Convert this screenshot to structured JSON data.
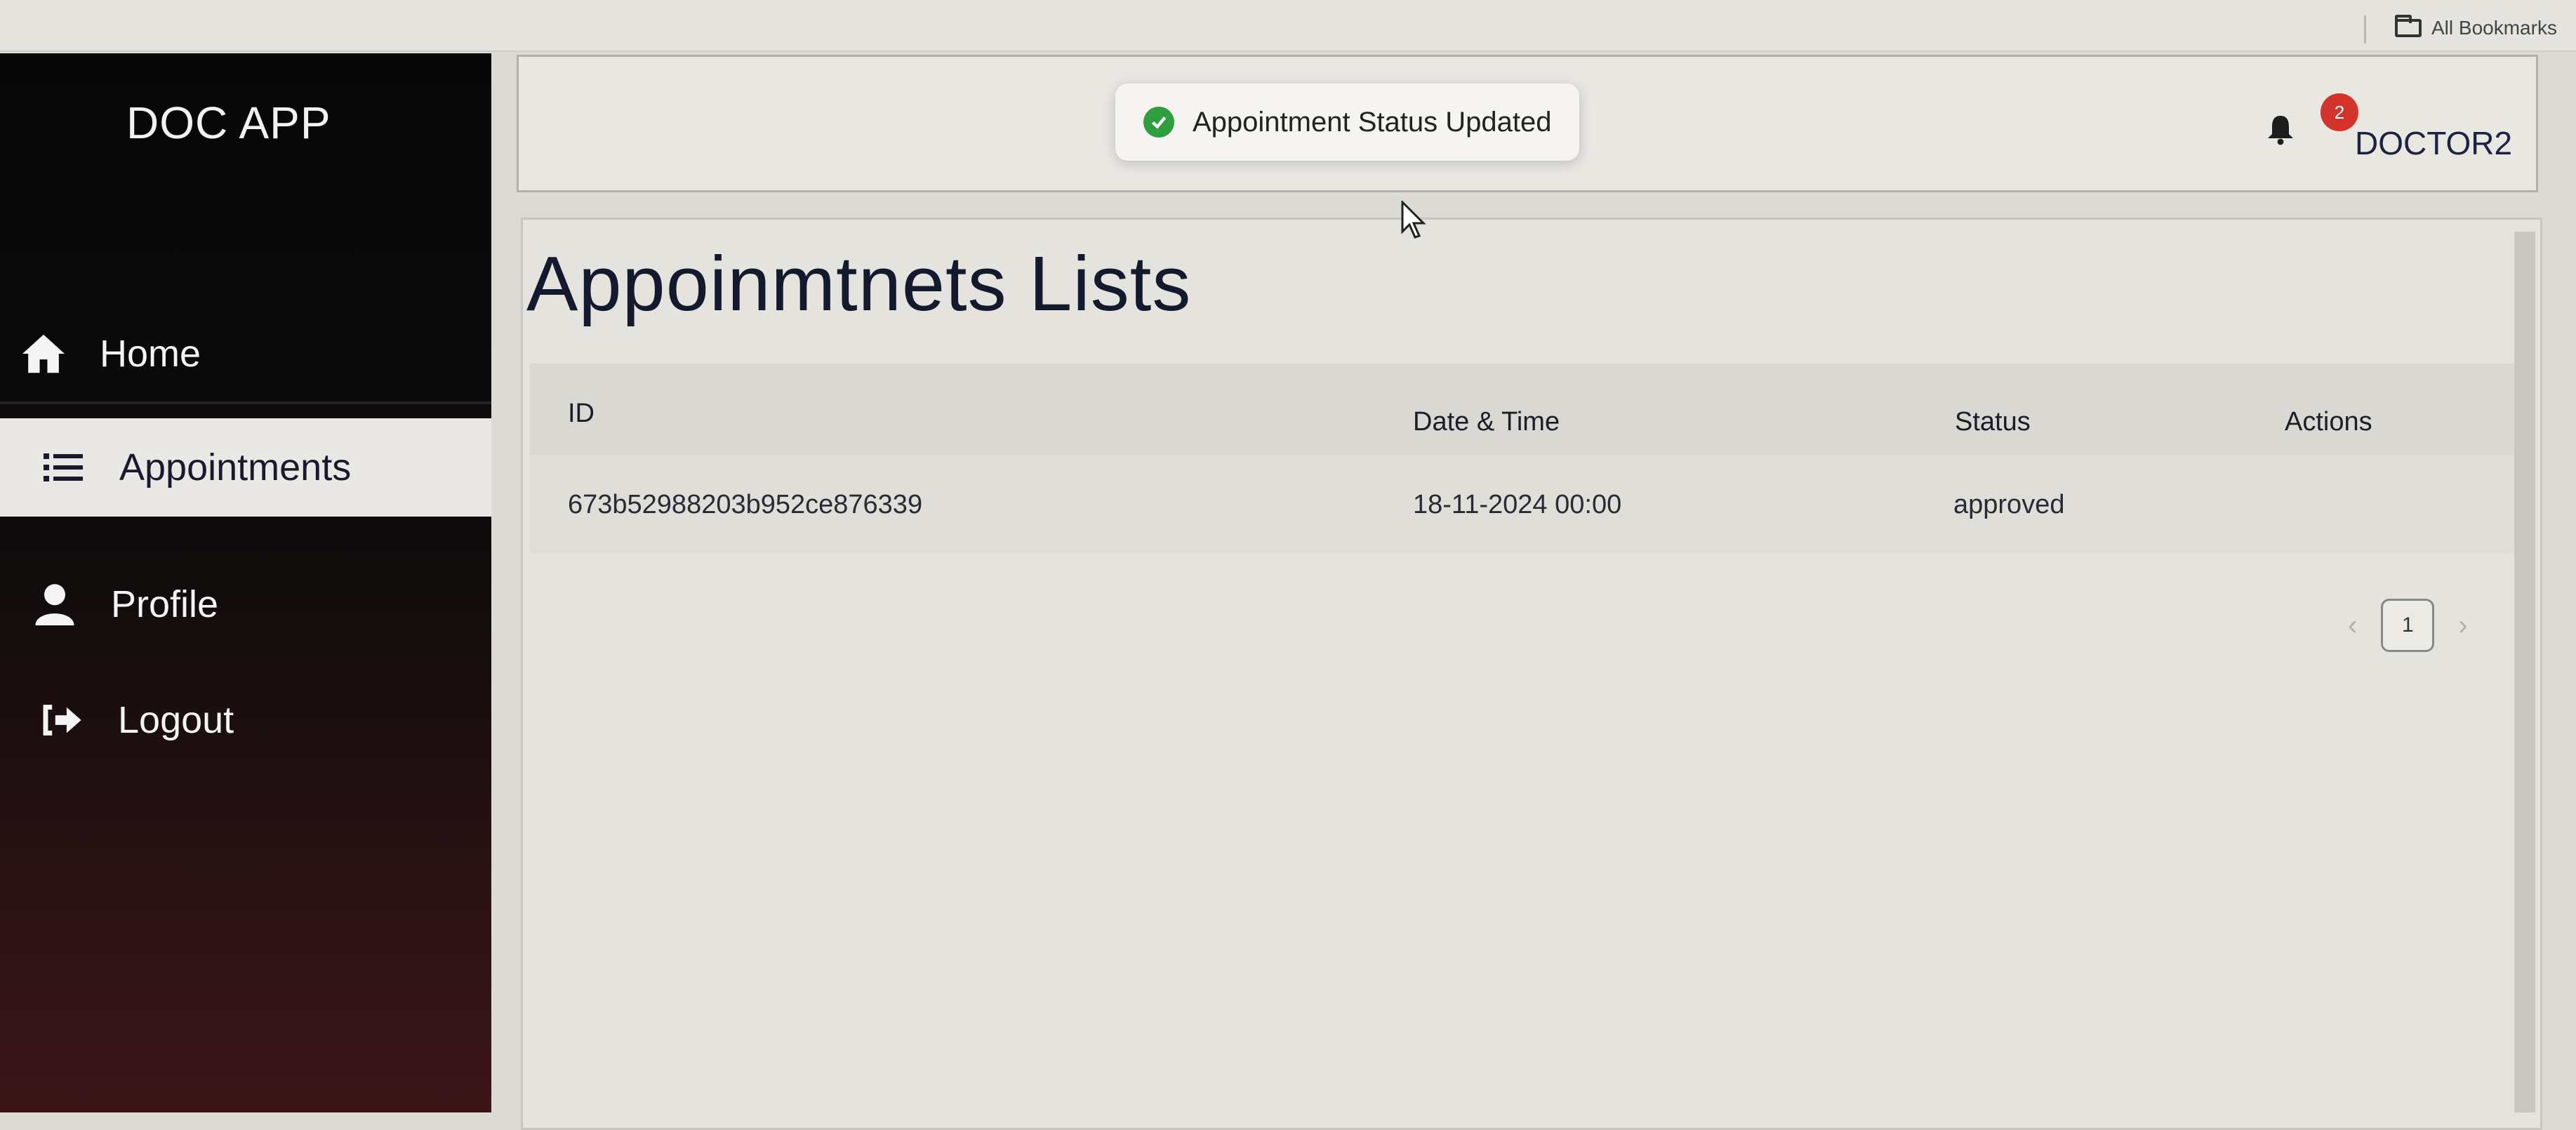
{
  "browser": {
    "bookmarks_label": "All Bookmarks"
  },
  "sidebar": {
    "brand": "DOC APP",
    "items": [
      {
        "label": "Home",
        "icon": "home-icon",
        "active": false
      },
      {
        "label": "Appointments",
        "icon": "list-icon",
        "active": true
      },
      {
        "label": "Profile",
        "icon": "user-icon",
        "active": false
      },
      {
        "label": "Logout",
        "icon": "logout-icon",
        "active": false
      }
    ]
  },
  "header": {
    "toast": {
      "message": "Appointment Status Updated",
      "icon": "check-circle-icon"
    },
    "notifications": {
      "icon": "bell-icon",
      "count": "2"
    },
    "user": "DOCTOR2"
  },
  "main": {
    "title": "Appoinmtnets Lists",
    "table": {
      "columns": [
        "ID",
        "Date & Time",
        "Status",
        "Actions"
      ],
      "rows": [
        {
          "id": "673b52988203b952ce876339",
          "datetime": "18-11-2024 00:00",
          "status": "approved",
          "actions": ""
        }
      ]
    },
    "pagination": {
      "prev": "‹",
      "current": "1",
      "next": "›"
    }
  },
  "colors": {
    "sidebar_top": "#070707",
    "sidebar_bottom": "#3c1518",
    "active_bg": "#e9e8e4",
    "toast_success": "#2e9e3e",
    "badge": "#d4332c"
  }
}
